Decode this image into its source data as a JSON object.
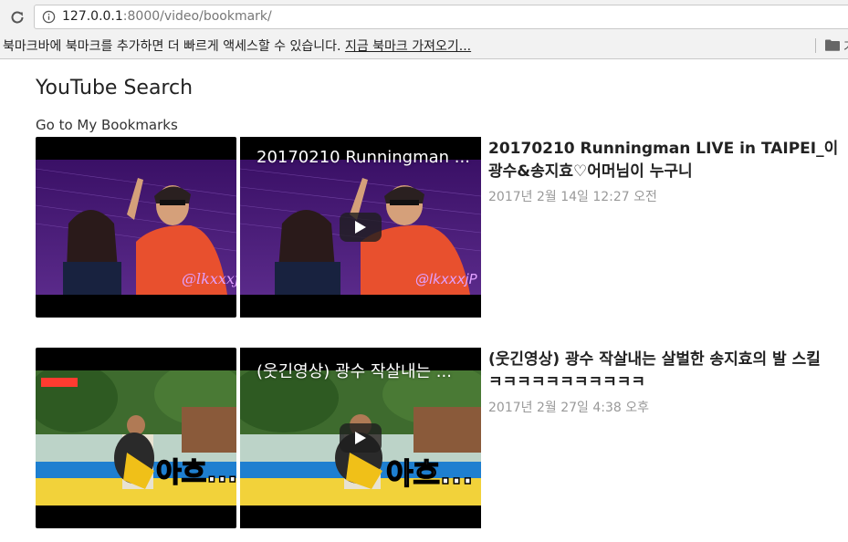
{
  "browser": {
    "url_host": "127.0.0.1",
    "url_rest": ":8000/video/bookmark/",
    "bookmark_bar_message": "북마크바에 북마크를 추가하면 더 빠르게 액세스할 수 있습니다.",
    "bookmark_bar_link": "지금 북마크 가져오기...",
    "other_bookmarks_label": "기"
  },
  "page": {
    "title": "YouTube Search",
    "bookmarks_link": "Go to My Bookmarks"
  },
  "videos": [
    {
      "player_title": "20170210 Runningman ...",
      "title": "20170210 Runningman LIVE in TAIPEI_이광수&송지효♡어머님이 누구니",
      "date": "2017년 2월 14일 12:27 오전",
      "watermark": "@lkxxxjP"
    },
    {
      "player_title": "(웃긴영상) 광수 작살내는 ...",
      "title_line1": "(웃긴영상) 광수 작살내는 살벌한 송지효의 발 스킬",
      "title_line2": "ㅋㅋㅋㅋㅋㅋㅋㅋㅋㅋㅋ",
      "date": "2017년 2월 27일 4:38 오후",
      "caption": "아흐..."
    }
  ]
}
